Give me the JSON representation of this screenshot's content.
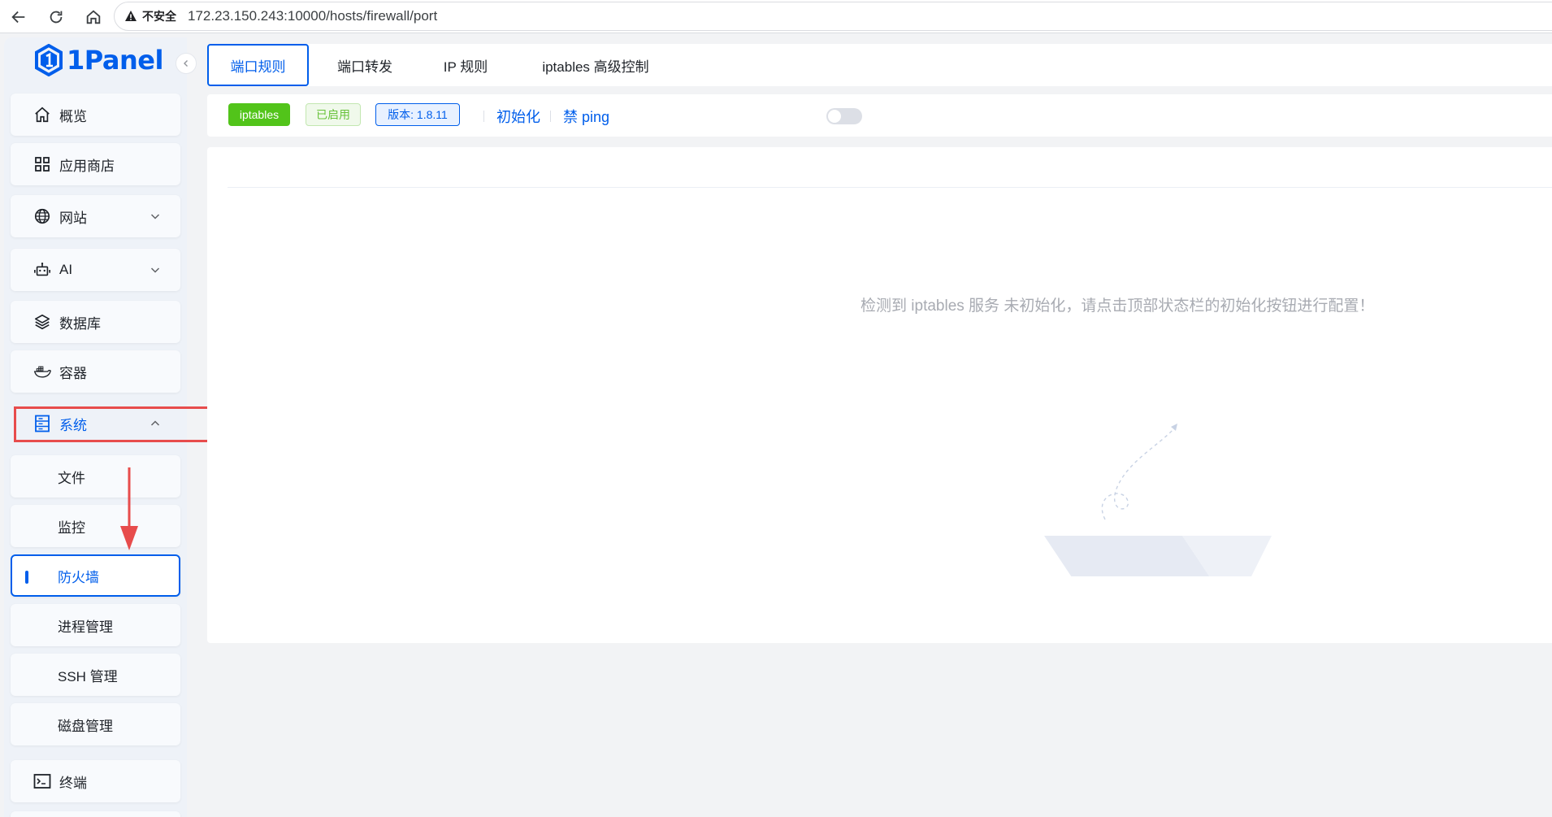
{
  "browser": {
    "security_label": "不安全",
    "url": "172.23.150.243:10000/hosts/firewall/port"
  },
  "app": {
    "logo_text": "1Panel"
  },
  "sidebar": {
    "items": [
      {
        "label": "概览",
        "icon": "home-icon"
      },
      {
        "label": "应用商店",
        "icon": "grid-icon"
      },
      {
        "label": "网站",
        "icon": "globe-icon",
        "expandable": true
      },
      {
        "label": "AI",
        "icon": "robot-icon",
        "expandable": true
      },
      {
        "label": "数据库",
        "icon": "layers-icon"
      },
      {
        "label": "容器",
        "icon": "docker-icon"
      },
      {
        "label": "系统",
        "icon": "server-icon",
        "expanded": true
      }
    ],
    "sub_items": [
      {
        "label": "文件"
      },
      {
        "label": "监控"
      },
      {
        "label": "防火墙",
        "active": true
      },
      {
        "label": "进程管理"
      },
      {
        "label": "SSH 管理"
      },
      {
        "label": "磁盘管理"
      }
    ],
    "bottom_items": [
      {
        "label": "终端",
        "icon": "terminal-icon"
      }
    ]
  },
  "tabs": [
    {
      "label": "端口规则",
      "active": true
    },
    {
      "label": "端口转发"
    },
    {
      "label": "IP 规则"
    },
    {
      "label": "iptables 高级控制"
    }
  ],
  "status": {
    "service_tag": "iptables",
    "state_tag": "已启用",
    "version_tag": "版本: 1.8.11",
    "init_link": "初始化",
    "ping_label": "禁 ping",
    "ping_enabled": false
  },
  "main": {
    "empty_message": "检测到 iptables 服务 未初始化，请点击顶部状态栏的初始化按钮进行配置！"
  },
  "colors": {
    "primary": "#005eeb",
    "success": "#52c41a",
    "annotation": "#e74c4c"
  }
}
